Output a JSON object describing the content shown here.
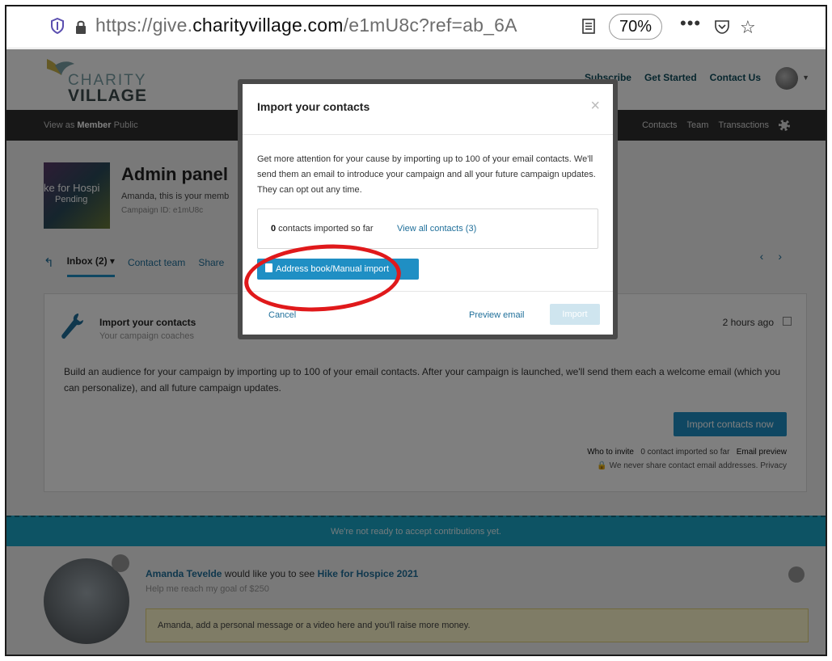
{
  "browser": {
    "url_prefix": "https://give.",
    "url_domain": "charityvillage.com",
    "url_suffix": "/e1mU8c?ref=ab_6A",
    "zoom": "70%",
    "more": "•••"
  },
  "header": {
    "logo_top": "CHARITY",
    "logo_bottom": "VILLAGE",
    "links": [
      "Subscribe",
      "Get Started",
      "Contact Us"
    ]
  },
  "darkbar": {
    "view_as": "View as",
    "member": "Member",
    "public": "Public",
    "right_items": [
      "Contacts",
      "Team",
      "Transactions"
    ]
  },
  "admin": {
    "thumb_title": "ke for Hospi",
    "thumb_status": "Pending",
    "title": "Admin panel",
    "subtitle": "Amanda, this is your memb",
    "campaign_id": "Campaign ID: e1mU8c"
  },
  "tabs": {
    "inbox": "Inbox (2) ▾",
    "contact_team": "Contact team",
    "share": "Share"
  },
  "card": {
    "title": "Import your contacts",
    "subtitle": "Your campaign coaches",
    "time": "2 hours ago",
    "body": "Build an audience for your campaign by importing up to 100 of your email contacts. After your campaign is launched, we'll send them each a welcome email (which you can personalize), and all future campaign updates.",
    "button": "Import contacts now",
    "who_to_invite": "Who to invite",
    "imported": "0 contact imported so far",
    "email_preview": "Email preview",
    "privacy_note": "We never share contact email addresses.",
    "privacy": "Privacy"
  },
  "banner": {
    "text": "We're not ready to accept contributions yet."
  },
  "invite": {
    "name": "Amanda Tevelde",
    "middle": " would like you to see ",
    "campaign": "Hike for Hospice 2021",
    "goal": "Help me reach my goal of $250",
    "message": "Amanda, add a personal message or a video here and you'll raise more money."
  },
  "modal": {
    "title": "Import your contacts",
    "close": "×",
    "description": "Get more attention for your cause by importing up to 100 of your email contacts. We'll send them an email to introduce your campaign and all your future campaign updates. They can opt out any time.",
    "count": "0",
    "count_label": " contacts imported so far",
    "view_all": "View all contacts (3)",
    "address_book": "Address book/Manual import",
    "cancel": "Cancel",
    "preview": "Preview email",
    "import": "Import"
  }
}
